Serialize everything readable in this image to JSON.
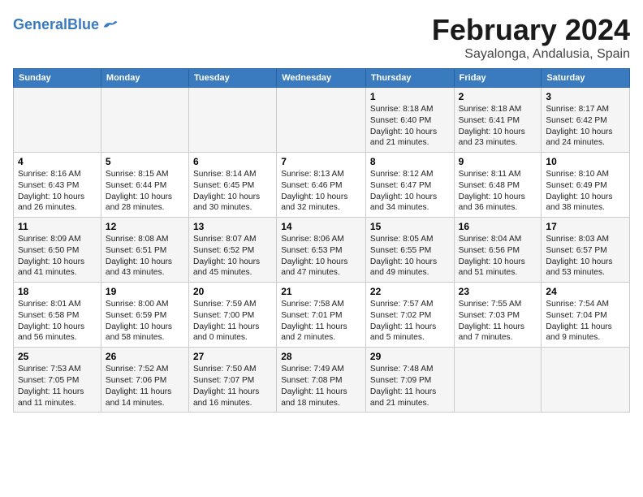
{
  "app": {
    "name": "GeneralBlue",
    "logo_text_1": "General",
    "logo_text_2": "Blue"
  },
  "calendar": {
    "month": "February 2024",
    "location": "Sayalonga, Andalusia, Spain",
    "headers": [
      "Sunday",
      "Monday",
      "Tuesday",
      "Wednesday",
      "Thursday",
      "Friday",
      "Saturday"
    ],
    "weeks": [
      [
        {
          "day": "",
          "details": ""
        },
        {
          "day": "",
          "details": ""
        },
        {
          "day": "",
          "details": ""
        },
        {
          "day": "",
          "details": ""
        },
        {
          "day": "1",
          "details": "Sunrise: 8:18 AM\nSunset: 6:40 PM\nDaylight: 10 hours\nand 21 minutes."
        },
        {
          "day": "2",
          "details": "Sunrise: 8:18 AM\nSunset: 6:41 PM\nDaylight: 10 hours\nand 23 minutes."
        },
        {
          "day": "3",
          "details": "Sunrise: 8:17 AM\nSunset: 6:42 PM\nDaylight: 10 hours\nand 24 minutes."
        }
      ],
      [
        {
          "day": "4",
          "details": "Sunrise: 8:16 AM\nSunset: 6:43 PM\nDaylight: 10 hours\nand 26 minutes."
        },
        {
          "day": "5",
          "details": "Sunrise: 8:15 AM\nSunset: 6:44 PM\nDaylight: 10 hours\nand 28 minutes."
        },
        {
          "day": "6",
          "details": "Sunrise: 8:14 AM\nSunset: 6:45 PM\nDaylight: 10 hours\nand 30 minutes."
        },
        {
          "day": "7",
          "details": "Sunrise: 8:13 AM\nSunset: 6:46 PM\nDaylight: 10 hours\nand 32 minutes."
        },
        {
          "day": "8",
          "details": "Sunrise: 8:12 AM\nSunset: 6:47 PM\nDaylight: 10 hours\nand 34 minutes."
        },
        {
          "day": "9",
          "details": "Sunrise: 8:11 AM\nSunset: 6:48 PM\nDaylight: 10 hours\nand 36 minutes."
        },
        {
          "day": "10",
          "details": "Sunrise: 8:10 AM\nSunset: 6:49 PM\nDaylight: 10 hours\nand 38 minutes."
        }
      ],
      [
        {
          "day": "11",
          "details": "Sunrise: 8:09 AM\nSunset: 6:50 PM\nDaylight: 10 hours\nand 41 minutes."
        },
        {
          "day": "12",
          "details": "Sunrise: 8:08 AM\nSunset: 6:51 PM\nDaylight: 10 hours\nand 43 minutes."
        },
        {
          "day": "13",
          "details": "Sunrise: 8:07 AM\nSunset: 6:52 PM\nDaylight: 10 hours\nand 45 minutes."
        },
        {
          "day": "14",
          "details": "Sunrise: 8:06 AM\nSunset: 6:53 PM\nDaylight: 10 hours\nand 47 minutes."
        },
        {
          "day": "15",
          "details": "Sunrise: 8:05 AM\nSunset: 6:55 PM\nDaylight: 10 hours\nand 49 minutes."
        },
        {
          "day": "16",
          "details": "Sunrise: 8:04 AM\nSunset: 6:56 PM\nDaylight: 10 hours\nand 51 minutes."
        },
        {
          "day": "17",
          "details": "Sunrise: 8:03 AM\nSunset: 6:57 PM\nDaylight: 10 hours\nand 53 minutes."
        }
      ],
      [
        {
          "day": "18",
          "details": "Sunrise: 8:01 AM\nSunset: 6:58 PM\nDaylight: 10 hours\nand 56 minutes."
        },
        {
          "day": "19",
          "details": "Sunrise: 8:00 AM\nSunset: 6:59 PM\nDaylight: 10 hours\nand 58 minutes."
        },
        {
          "day": "20",
          "details": "Sunrise: 7:59 AM\nSunset: 7:00 PM\nDaylight: 11 hours\nand 0 minutes."
        },
        {
          "day": "21",
          "details": "Sunrise: 7:58 AM\nSunset: 7:01 PM\nDaylight: 11 hours\nand 2 minutes."
        },
        {
          "day": "22",
          "details": "Sunrise: 7:57 AM\nSunset: 7:02 PM\nDaylight: 11 hours\nand 5 minutes."
        },
        {
          "day": "23",
          "details": "Sunrise: 7:55 AM\nSunset: 7:03 PM\nDaylight: 11 hours\nand 7 minutes."
        },
        {
          "day": "24",
          "details": "Sunrise: 7:54 AM\nSunset: 7:04 PM\nDaylight: 11 hours\nand 9 minutes."
        }
      ],
      [
        {
          "day": "25",
          "details": "Sunrise: 7:53 AM\nSunset: 7:05 PM\nDaylight: 11 hours\nand 11 minutes."
        },
        {
          "day": "26",
          "details": "Sunrise: 7:52 AM\nSunset: 7:06 PM\nDaylight: 11 hours\nand 14 minutes."
        },
        {
          "day": "27",
          "details": "Sunrise: 7:50 AM\nSunset: 7:07 PM\nDaylight: 11 hours\nand 16 minutes."
        },
        {
          "day": "28",
          "details": "Sunrise: 7:49 AM\nSunset: 7:08 PM\nDaylight: 11 hours\nand 18 minutes."
        },
        {
          "day": "29",
          "details": "Sunrise: 7:48 AM\nSunset: 7:09 PM\nDaylight: 11 hours\nand 21 minutes."
        },
        {
          "day": "",
          "details": ""
        },
        {
          "day": "",
          "details": ""
        }
      ]
    ]
  }
}
